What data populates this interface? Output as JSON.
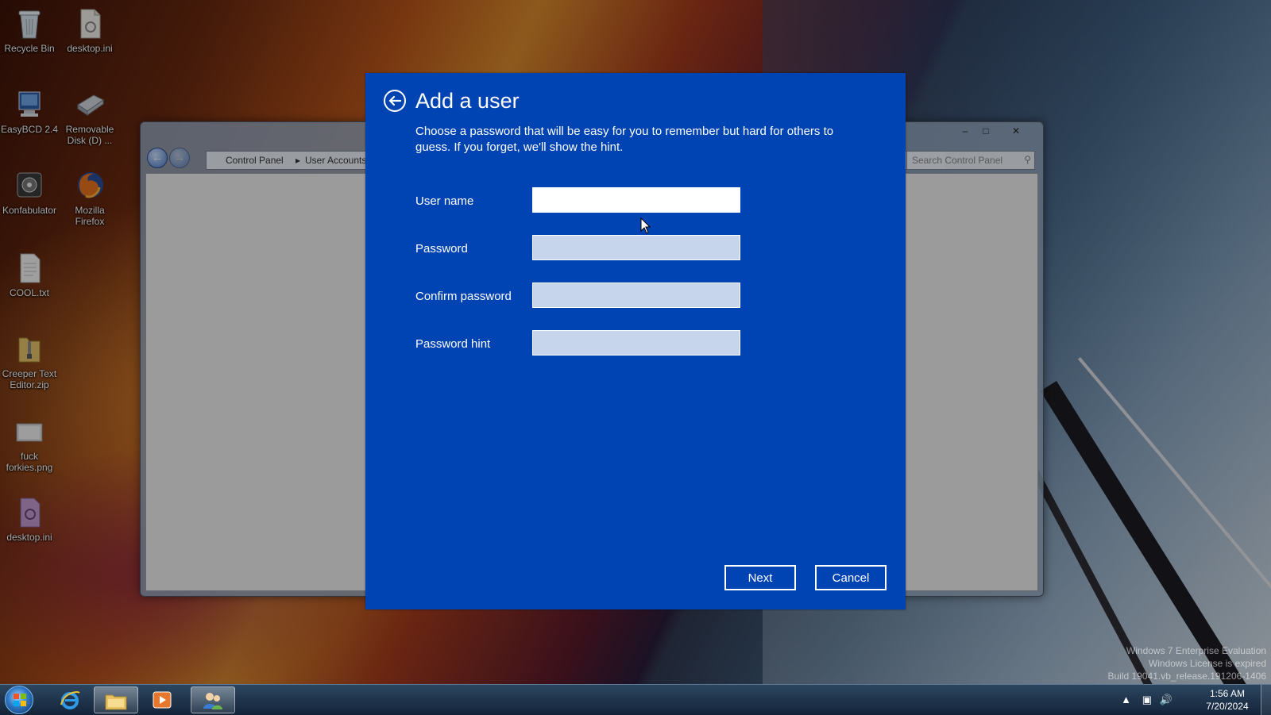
{
  "desktop": {
    "icons": [
      {
        "label": "Recycle Bin",
        "icon": "recycle-bin-icon"
      },
      {
        "label": "desktop.ini",
        "icon": "ini-file-icon"
      },
      {
        "label": "EasyBCD 2.4",
        "icon": "easybcd-icon"
      },
      {
        "label": "Removable Disk (D) ...",
        "icon": "removable-disk-icon"
      },
      {
        "label": "Konfabulator",
        "icon": "konfabulator-icon"
      },
      {
        "label": "Mozilla Firefox",
        "icon": "firefox-icon"
      },
      {
        "label": "COOL.txt",
        "icon": "text-file-icon"
      },
      {
        "label": "Creeper Text Editor.zip",
        "icon": "zip-folder-icon"
      },
      {
        "label": "fuck forkies.png",
        "icon": "image-file-icon"
      },
      {
        "label": "desktop.ini",
        "icon": "ini-file-icon"
      }
    ]
  },
  "control_panel_window": {
    "breadcrumb": [
      "Control Panel",
      "User Accounts"
    ],
    "search_placeholder": "Search Control Panel"
  },
  "dialog": {
    "title": "Add a user",
    "description": "Choose a password that will be easy for you to remember but hard for others to guess. If you forget, we'll show the hint.",
    "fields": {
      "username_label": "User name",
      "username_value": "",
      "password_label": "Password",
      "password_value": "",
      "confirm_label": "Confirm password",
      "confirm_value": "",
      "hint_label": "Password hint",
      "hint_value": ""
    },
    "next_label": "Next",
    "cancel_label": "Cancel",
    "accent_color": "#0044b3"
  },
  "watermark": {
    "line1": "Windows 7 Enterprise Evaluation",
    "line2": "Windows License is expired",
    "line3": "Build 19041.vb_release.191206-1406"
  },
  "taskbar": {
    "pinned": [
      "internet-explorer-icon",
      "file-explorer-icon",
      "media-player-icon",
      "user-accounts-icon"
    ],
    "time": "1:56 AM",
    "date": "7/20/2024"
  }
}
